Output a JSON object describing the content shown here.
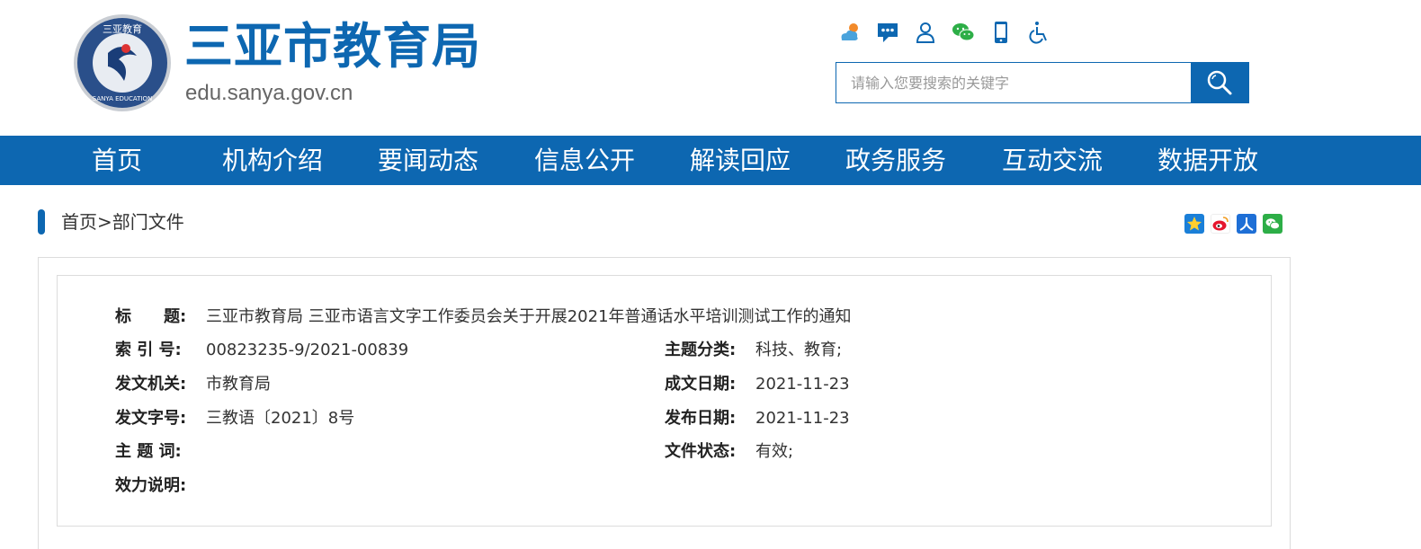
{
  "header": {
    "site_title": "三亚市教育局",
    "site_domain": "edu.sanya.gov.cn",
    "logo_text_top": "三亚教育",
    "logo_text_bottom": "SANYA EDUCATION",
    "icons": [
      "weather-icon",
      "message-icon",
      "user-icon",
      "wechat-icon",
      "mobile-icon",
      "accessibility-icon"
    ],
    "accent": "#0d67b1"
  },
  "search": {
    "placeholder": "请输入您要搜索的关键字",
    "value": ""
  },
  "nav": {
    "items": [
      "首页",
      "机构介绍",
      "要闻动态",
      "信息公开",
      "解读回应",
      "政务服务",
      "互动交流",
      "数据开放"
    ]
  },
  "breadcrumb": {
    "home": "首页",
    "separator": ">",
    "current": "部门文件"
  },
  "share": {
    "icons": [
      "qzone-icon",
      "weibo-icon",
      "renren-icon",
      "wechat-share-icon"
    ]
  },
  "doc": {
    "title_label": "标　　题:",
    "title_value": "三亚市教育局 三亚市语言文字工作委员会关于开展2021年普通话水平培训测试工作的通知",
    "index_label": "索 引 号:",
    "index_value": "00823235-9/2021-00839",
    "category_label": "主题分类:",
    "category_value": "科技、教育;",
    "issuer_label": "发文机关:",
    "issuer_value": "市教育局",
    "written_date_label": "成文日期:",
    "written_date_value": "2021-11-23",
    "doc_number_label": "发文字号:",
    "doc_number_value": "三教语〔2021〕8号",
    "publish_date_label": "发布日期:",
    "publish_date_value": "2021-11-23",
    "keywords_label": "主 题 词:",
    "keywords_value": "",
    "status_label": "文件状态:",
    "status_value": "有效;",
    "validity_label": "效力说明:",
    "validity_value": ""
  }
}
